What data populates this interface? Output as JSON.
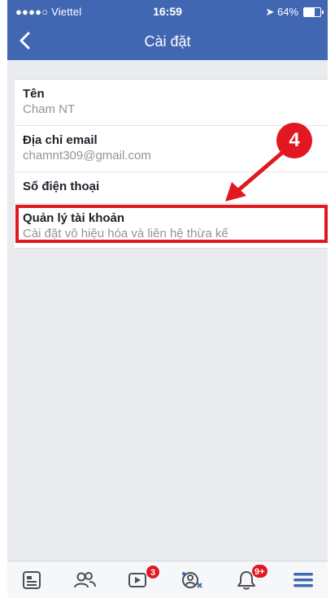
{
  "status_bar": {
    "carrier": "●●●●○ Viettel",
    "time": "16:59",
    "battery_text": "64%",
    "battery_level": 0.64
  },
  "header": {
    "title": "Cài đặt",
    "back_icon": "chevron-left-icon"
  },
  "settings": {
    "items": [
      {
        "label": "Tên",
        "value": "Cham NT"
      },
      {
        "label": "Địa chỉ email",
        "value": "chamnt309@gmail.com"
      },
      {
        "label": "Số điện thoại",
        "value": ""
      },
      {
        "label": "Quản lý tài khoản",
        "value": "Cài đặt vô hiệu hóa và liên hệ thừa kế"
      }
    ]
  },
  "annotation": {
    "step_number": "4",
    "color": "#e11820"
  },
  "tabbar": {
    "tabs": [
      {
        "icon": "news-feed-icon"
      },
      {
        "icon": "friends-icon"
      },
      {
        "icon": "video-icon",
        "badge": "3"
      },
      {
        "icon": "profile-icon"
      },
      {
        "icon": "notifications-icon",
        "badge": "9+"
      },
      {
        "icon": "menu-icon",
        "active": true
      }
    ]
  },
  "colors": {
    "brand": "#4267b2",
    "background": "#e9ebee"
  }
}
